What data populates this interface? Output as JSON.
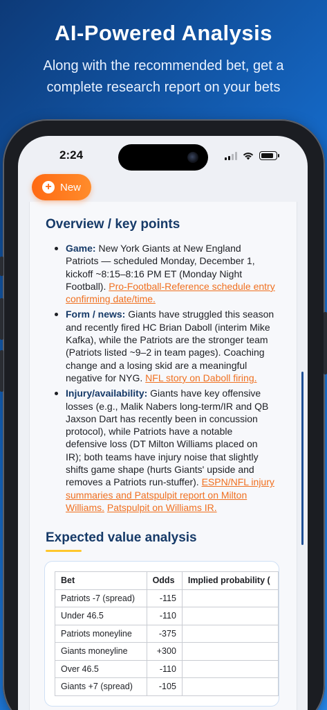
{
  "hero": {
    "title": "AI-Powered Analysis",
    "subtitle": "Along with the recommended bet, get a complete research report on your bets"
  },
  "status_bar": {
    "time": "2:24"
  },
  "new_button": {
    "label": "New",
    "icon": "plus-icon"
  },
  "overview": {
    "heading": "Overview / key points",
    "items": [
      {
        "label": "Game:",
        "text": " New York Giants at New England Patriots — scheduled Monday, December 1, kickoff ~8:15–8:16 PM ET (Monday Night Football). ",
        "links": [
          "Pro-Football-Reference schedule entry confirming date/time."
        ]
      },
      {
        "label": "Form / news:",
        "text": " Giants have struggled this season and recently fired HC Brian Daboll (interim Mike Kafka), while the Patriots are the stronger team (Patriots listed ~9–2 in team pages). Coaching change and a losing skid are a meaningful negative for NYG. ",
        "links": [
          "NFL story on Daboll firing."
        ]
      },
      {
        "label": "Injury/availability:",
        "text": " Giants have key offensive losses (e.g., Malik Nabers long-term/IR and QB Jaxson Dart has recently been in concussion protocol), while Patriots have a notable defensive loss (DT Milton Williams placed on IR); both teams have injury noise that slightly shifts game shape (hurts Giants' upside and removes a Patriots run-stuffer). ",
        "links": [
          "ESPN/NFL injury summaries and Patspulpit report on Milton Williams.",
          "Patspulpit on Williams IR."
        ]
      }
    ]
  },
  "ev": {
    "heading": "Expected value analysis",
    "columns": [
      "Bet",
      "Odds",
      "Implied probability ("
    ],
    "rows": [
      {
        "bet": "Patriots -7 (spread)",
        "odds": "-115",
        "implied": ""
      },
      {
        "bet": "Under 46.5",
        "odds": "-110",
        "implied": ""
      },
      {
        "bet": "Patriots moneyline",
        "odds": "-375",
        "implied": ""
      },
      {
        "bet": "Giants moneyline",
        "odds": "+300",
        "implied": ""
      },
      {
        "bet": "Over 46.5",
        "odds": "-110",
        "implied": ""
      },
      {
        "bet": "Giants +7 (spread)",
        "odds": "-105",
        "implied": ""
      }
    ]
  },
  "colors": {
    "accent": "#ff7a1a",
    "heading": "#163a68",
    "link": "#f07020",
    "underline": "#ffc72c"
  }
}
